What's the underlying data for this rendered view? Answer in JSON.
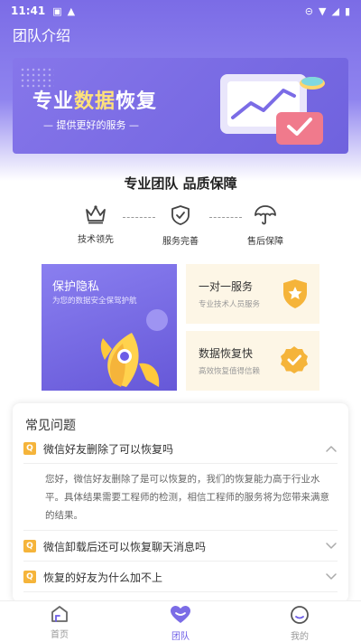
{
  "status_bar": {
    "time": "11:41"
  },
  "app": {
    "title": "团队介绍"
  },
  "banner": {
    "title_part1": "专业",
    "title_part2": "数据",
    "title_part3": "恢复",
    "subtitle": "— 提供更好的服务 —"
  },
  "section": {
    "title": "专业团队 品质保障"
  },
  "features": [
    {
      "label": "技术领先",
      "icon": "crown-icon"
    },
    {
      "label": "服务完善",
      "icon": "shield-check-icon"
    },
    {
      "label": "售后保障",
      "icon": "umbrella-icon"
    }
  ],
  "cards": {
    "privacy": {
      "title": "保护隐私",
      "desc": "为您的数据安全保驾护航"
    },
    "service": {
      "title": "一对一服务",
      "desc": "专业技术人员服务"
    },
    "recovery": {
      "title": "数据恢复快",
      "desc": "高效恢复值得信赖"
    }
  },
  "faq": {
    "heading": "常见问题",
    "badge": "Q",
    "items": [
      {
        "question": "微信好友删除了可以恢复吗",
        "expanded": true,
        "answer": "您好，微信好友删除了是可以恢复的，我们的恢复能力高于行业水平。具体结果需要工程师的检测，相信工程师的服务将为您带来满意的结果。"
      },
      {
        "question": "微信卸载后还可以恢复聊天消息吗",
        "expanded": false
      },
      {
        "question": "恢复的好友为什么加不上",
        "expanded": false
      }
    ]
  },
  "tabbar": {
    "active": "team",
    "items": [
      {
        "id": "home",
        "label": "首页",
        "icon": "home-icon"
      },
      {
        "id": "team",
        "label": "团队",
        "icon": "heart-icon"
      },
      {
        "id": "mine",
        "label": "我的",
        "icon": "smiley-icon"
      }
    ]
  },
  "colors": {
    "primary": "#7b6ce6",
    "accent_yellow": "#f5b43a",
    "card_cream": "#fdf6e6"
  }
}
